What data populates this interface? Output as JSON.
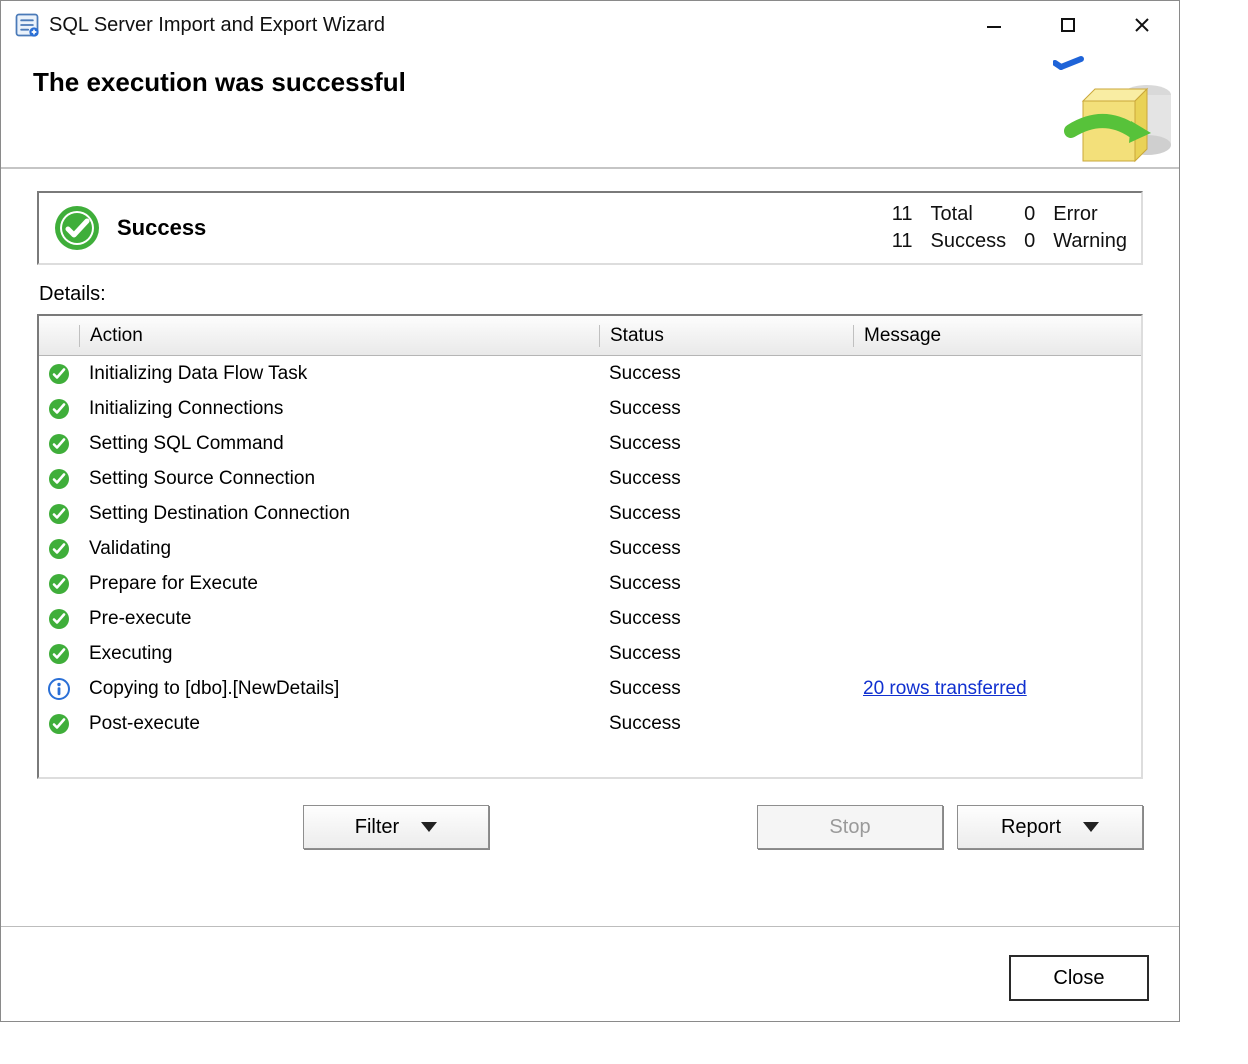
{
  "window": {
    "title": "SQL Server Import and Export Wizard"
  },
  "header": {
    "heading": "The execution was successful"
  },
  "summary": {
    "status_label": "Success",
    "counts": {
      "total_value": "11",
      "total_label": "Total",
      "error_value": "0",
      "error_label": "Error",
      "success_value": "11",
      "success_label": "Success",
      "warning_value": "0",
      "warning_label": "Warning"
    }
  },
  "details_label": "Details:",
  "columns": {
    "action": "Action",
    "status": "Status",
    "message": "Message"
  },
  "rows": [
    {
      "icon": "check",
      "action": "Initializing Data Flow Task",
      "status": "Success",
      "message": "",
      "link": false
    },
    {
      "icon": "check",
      "action": "Initializing Connections",
      "status": "Success",
      "message": "",
      "link": false
    },
    {
      "icon": "check",
      "action": "Setting SQL Command",
      "status": "Success",
      "message": "",
      "link": false
    },
    {
      "icon": "check",
      "action": "Setting Source Connection",
      "status": "Success",
      "message": "",
      "link": false
    },
    {
      "icon": "check",
      "action": "Setting Destination Connection",
      "status": "Success",
      "message": "",
      "link": false
    },
    {
      "icon": "check",
      "action": "Validating",
      "status": "Success",
      "message": "",
      "link": false
    },
    {
      "icon": "check",
      "action": "Prepare for Execute",
      "status": "Success",
      "message": "",
      "link": false
    },
    {
      "icon": "check",
      "action": "Pre-execute",
      "status": "Success",
      "message": "",
      "link": false
    },
    {
      "icon": "check",
      "action": "Executing",
      "status": "Success",
      "message": "",
      "link": false
    },
    {
      "icon": "info",
      "action": "Copying to [dbo].[NewDetails]",
      "status": "Success",
      "message": "20 rows transferred",
      "link": true
    },
    {
      "icon": "check",
      "action": "Post-execute",
      "status": "Success",
      "message": "",
      "link": false
    }
  ],
  "buttons": {
    "filter": "Filter",
    "stop": "Stop",
    "report": "Report",
    "close": "Close"
  }
}
